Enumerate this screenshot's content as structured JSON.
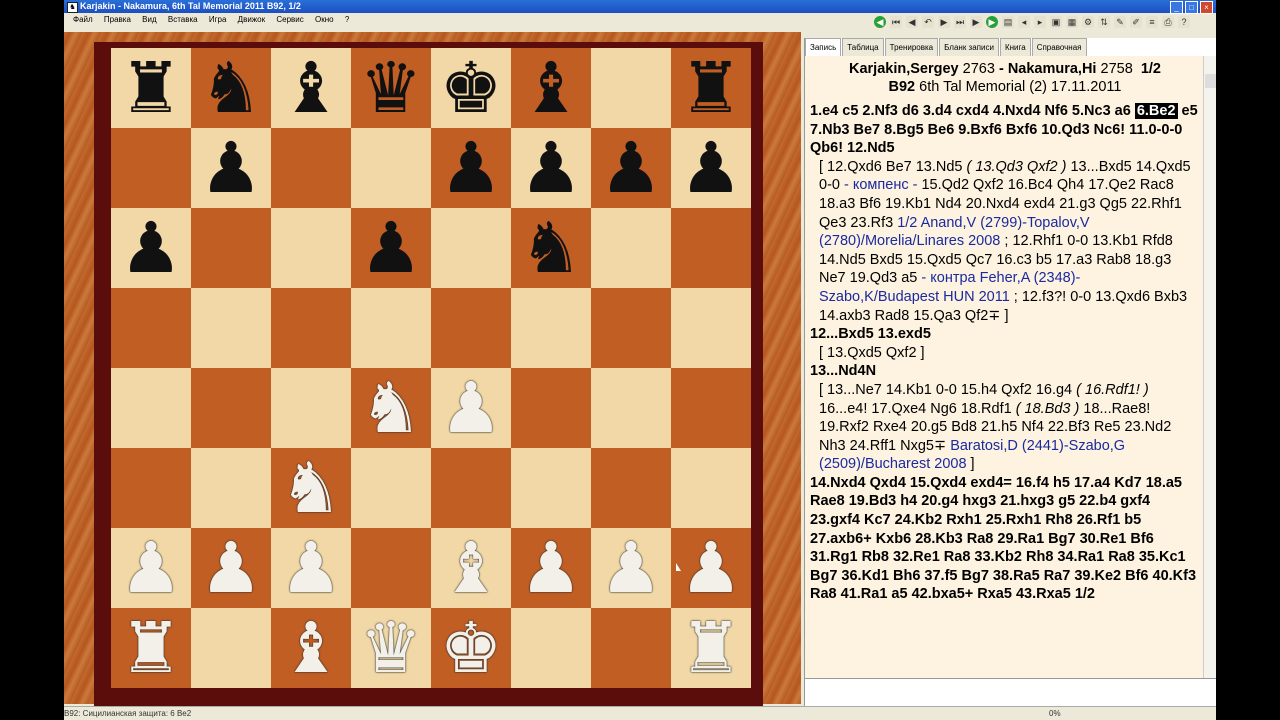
{
  "window": {
    "title": "Karjakin - Nakamura, 6th Tal Memorial 2011  B92, 1/2"
  },
  "menu": [
    "Файл",
    "Правка",
    "Вид",
    "Вставка",
    "Игра",
    "Движок",
    "Сервис",
    "Окно",
    "?"
  ],
  "toolbar_icons": [
    "green-circle-left-icon",
    "first-icon",
    "prev-icon",
    "back-icon",
    "forward-icon",
    "next-icon",
    "last-icon",
    "green-circle-right-icon",
    "new-game-icon",
    "prev-game-icon",
    "next-game-icon",
    "save-icon",
    "database-icon",
    "settings-icon",
    "flip-icon",
    "edit-icon",
    "pencil-icon",
    "notation-icon",
    "print-icon",
    "help-icon"
  ],
  "tabs": [
    "Запись",
    "Таблица",
    "Тренировка",
    "Бланк записи",
    "Книга",
    "Справочная"
  ],
  "active_tab": "Запись",
  "board": {
    "ranks": [
      [
        {
          "p": "♜",
          "c": "b"
        },
        {
          "p": "♞",
          "c": "b"
        },
        {
          "p": "♝",
          "c": "b"
        },
        {
          "p": "♛",
          "c": "b"
        },
        {
          "p": "♚",
          "c": "b"
        },
        {
          "p": "♝",
          "c": "b"
        },
        {
          "p": "",
          "c": ""
        },
        {
          "p": "♜",
          "c": "b"
        }
      ],
      [
        {
          "p": "",
          "c": ""
        },
        {
          "p": "♟",
          "c": "b"
        },
        {
          "p": "",
          "c": ""
        },
        {
          "p": "",
          "c": ""
        },
        {
          "p": "♟",
          "c": "b"
        },
        {
          "p": "♟",
          "c": "b"
        },
        {
          "p": "♟",
          "c": "b"
        },
        {
          "p": "♟",
          "c": "b"
        }
      ],
      [
        {
          "p": "♟",
          "c": "b"
        },
        {
          "p": "",
          "c": ""
        },
        {
          "p": "",
          "c": ""
        },
        {
          "p": "♟",
          "c": "b"
        },
        {
          "p": "",
          "c": ""
        },
        {
          "p": "♞",
          "c": "b"
        },
        {
          "p": "",
          "c": ""
        },
        {
          "p": "",
          "c": ""
        }
      ],
      [
        {
          "p": "",
          "c": ""
        },
        {
          "p": "",
          "c": ""
        },
        {
          "p": "",
          "c": ""
        },
        {
          "p": "",
          "c": ""
        },
        {
          "p": "",
          "c": ""
        },
        {
          "p": "",
          "c": ""
        },
        {
          "p": "",
          "c": ""
        },
        {
          "p": "",
          "c": ""
        }
      ],
      [
        {
          "p": "",
          "c": ""
        },
        {
          "p": "",
          "c": ""
        },
        {
          "p": "",
          "c": ""
        },
        {
          "p": "♞",
          "c": "w"
        },
        {
          "p": "♟",
          "c": "w"
        },
        {
          "p": "",
          "c": ""
        },
        {
          "p": "",
          "c": ""
        },
        {
          "p": "",
          "c": ""
        }
      ],
      [
        {
          "p": "",
          "c": ""
        },
        {
          "p": "",
          "c": ""
        },
        {
          "p": "♞",
          "c": "w"
        },
        {
          "p": "",
          "c": ""
        },
        {
          "p": "",
          "c": ""
        },
        {
          "p": "",
          "c": ""
        },
        {
          "p": "",
          "c": ""
        },
        {
          "p": "",
          "c": ""
        }
      ],
      [
        {
          "p": "♟",
          "c": "w"
        },
        {
          "p": "♟",
          "c": "w"
        },
        {
          "p": "♟",
          "c": "w"
        },
        {
          "p": "",
          "c": ""
        },
        {
          "p": "♝",
          "c": "w"
        },
        {
          "p": "♟",
          "c": "w"
        },
        {
          "p": "♟",
          "c": "w"
        },
        {
          "p": "♟",
          "c": "w"
        }
      ],
      [
        {
          "p": "♜",
          "c": "w"
        },
        {
          "p": "",
          "c": ""
        },
        {
          "p": "♝",
          "c": "w"
        },
        {
          "p": "♛",
          "c": "w"
        },
        {
          "p": "♚",
          "c": "w"
        },
        {
          "p": "",
          "c": ""
        },
        {
          "p": "",
          "c": ""
        },
        {
          "p": "♜",
          "c": "w"
        }
      ]
    ]
  },
  "game": {
    "white": "Karjakin,Sergey",
    "white_elo": "2763",
    "sep": " - ",
    "black": "Nakamura,Hi",
    "black_elo": "2758",
    "result": "1/2",
    "eco": "B92",
    "event": "6th Tal Memorial (2) 17.11.2011"
  },
  "notation": {
    "m1a": "1.e4 c5 2.Nf3 d6 3.d4 cxd4 4.Nxd4 Nf6 5.Nc3 a6 ",
    "m1hl": "6.Be2",
    "m1b": " e5 7.Nb3 Be7 8.Bg5 Be6 9.Bxf6 Bxf6 10.Qd3 Nc6! 11.0-0-0 Qb6! 12.Nd5",
    "v1a": "[ 12.Qxd6 Be7 13.Nd5 ",
    "v1i": "( 13.Qd3 Qxf2 )",
    "v1b": " 13...Bxd5 14.Qxd5 0-0 ",
    "v1blue1": "- компенс -",
    "v1c": " 15.Qd2 Qxf2 16.Bc4 Qh4 17.Qe2 Rac8 18.a3 Bf6 19.Kb1 Nd4 20.Nxd4 exd4 21.g3 Qg5 22.Rhf1 Qe3 23.Rf3 ",
    "v1blue2": "1/2 Anand,V (2799)-Topalov,V (2780)/Morelia/Linares 2008",
    "v1d": " ; 12.Rhf1 0-0 13.Kb1 Rfd8 14.Nd5 Bxd5 15.Qxd5 Qc7 16.c3 b5 17.a3 Rab8 18.g3 Ne7 19.Qd3 a5 ",
    "v1blue3": "- контра Feher,A (2348)-Szabo,K/Budapest HUN 2011",
    "v1e": " ; 12.f3?! 0-0 13.Qxd6 Bxb3 14.axb3 Rad8 15.Qa3 Qf2∓ ]",
    "m2": "12...Bxd5 13.exd5",
    "v2": "[ 13.Qxd5 Qxf2 ]",
    "m3": "13...Nd4N",
    "v3a": "[ 13...Ne7 14.Kb1 0-0 15.h4 Qxf2 16.g4 ",
    "v3i1": "( 16.Rdf1! )",
    "v3b": " 16...e4! 17.Qxe4 Ng6 18.Rdf1 ",
    "v3i2": "( 18.Bd3 )",
    "v3c": " 18...Rae8! 19.Rxf2 Rxe4 20.g5 Bd8 21.h5 Nf4 22.Bf3 Re5 23.Nd2 Nh3 24.Rff1 Nxg5∓ ",
    "v3blue": "Baratosi,D (2441)-Szabo,G (2509)/Bucharest 2008",
    "v3d": " ]",
    "m4": "14.Nxd4 Qxd4 15.Qxd4 exd4= 16.f4 h5 17.a4 Kd7 18.a5 Rae8 19.Bd3 h4 20.g4 hxg3 21.hxg3 g5 22.b4 gxf4 23.gxf4 Kc7 24.Kb2 Rxh1 25.Rxh1 Rh8 26.Rf1 b5 27.axb6+ Kxb6 28.Kb3 Ra8 29.Ra1 Bg7 30.Re1 Bf6 31.Rg1 Rb8 32.Re1 Ra8 33.Kb2 Rh8 34.Ra1 Ra8 35.Kc1 Bg7 36.Kd1 Bh6 37.f5 Bg7 38.Ra5 Ra7 39.Ke2 Bf6 40.Kf3 Ra8 41.Ra1 a5 42.bxa5+ Rxa5 43.Rxa5 1/2"
  },
  "status": {
    "left": "B92: Сицилианская защита: 6 Be2",
    "progress": "0%"
  }
}
